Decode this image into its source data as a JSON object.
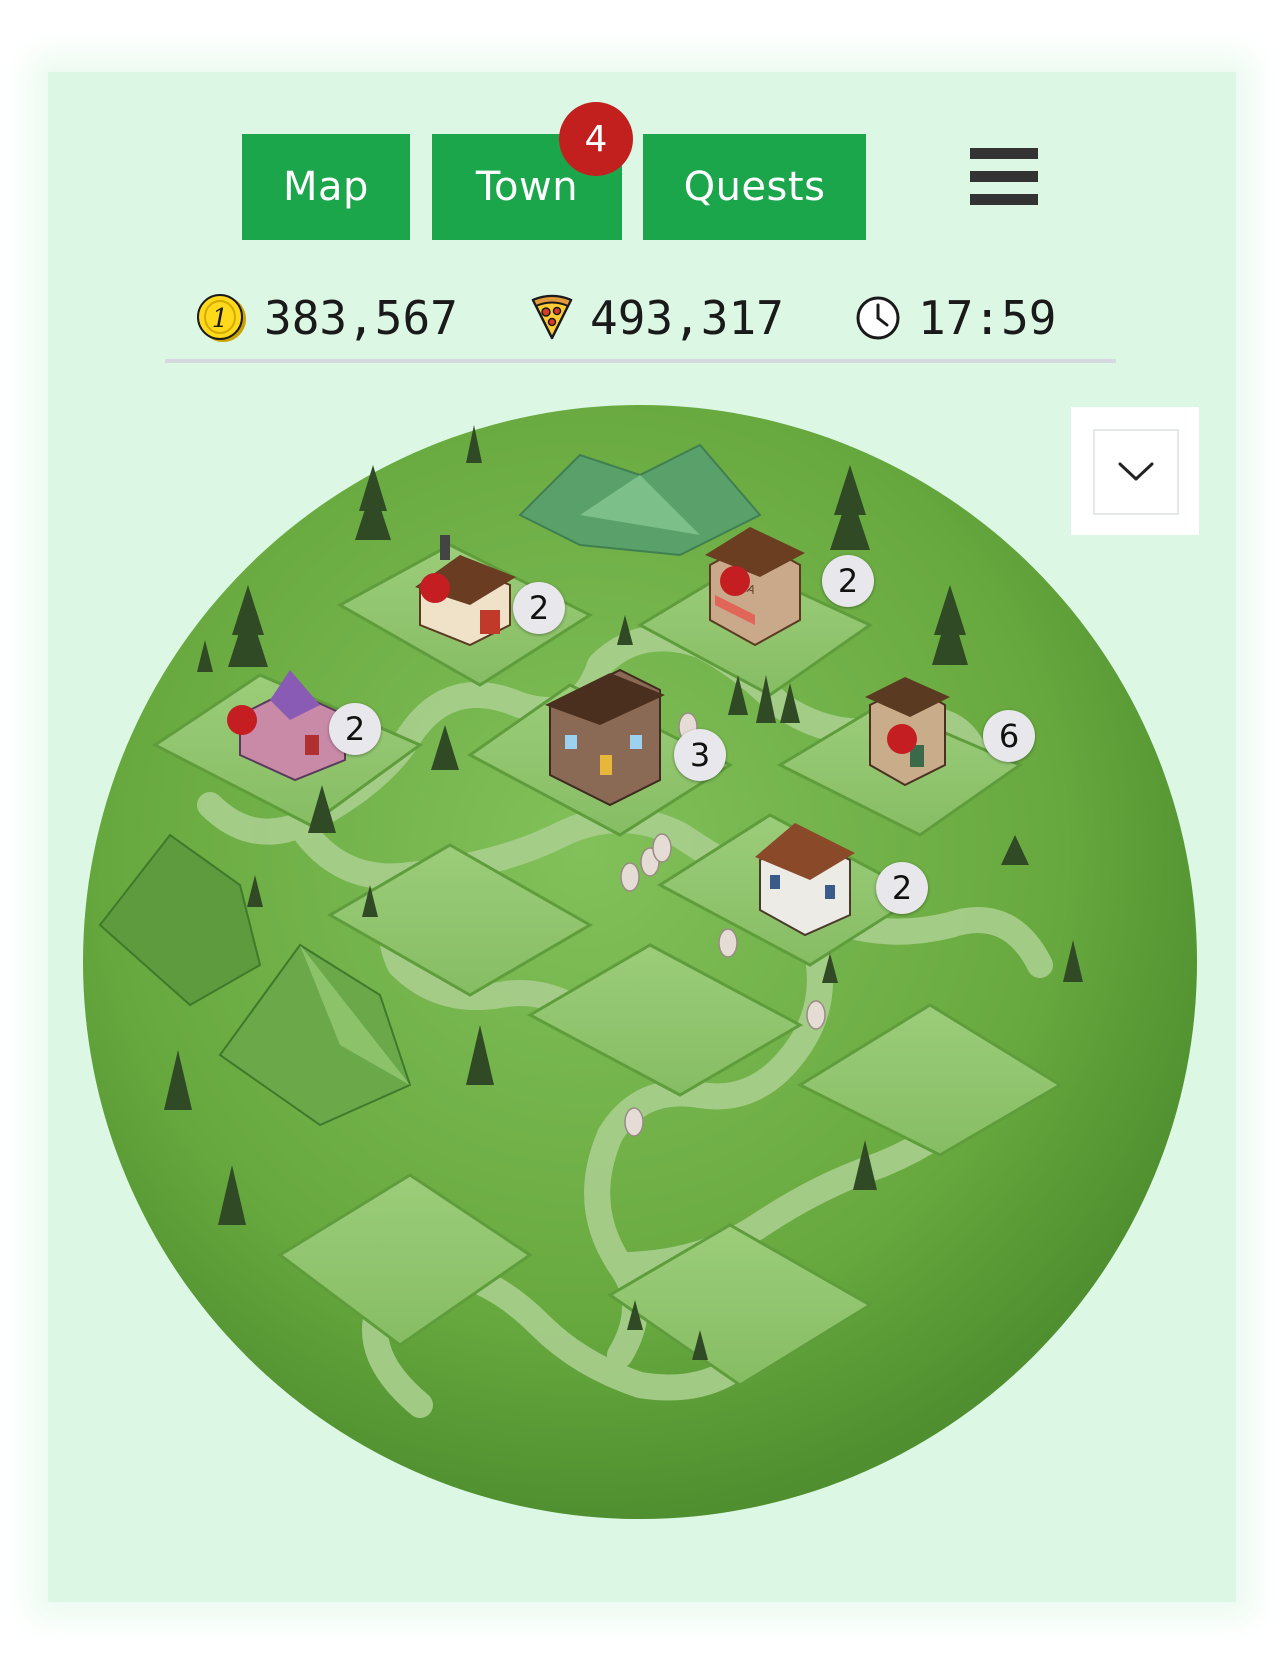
{
  "nav": {
    "map_label": "Map",
    "town_label": "Town",
    "town_badge": "4",
    "quests_label": "Quests",
    "menu_icon": "hamburger-menu-icon"
  },
  "stats": {
    "coins": "383,567",
    "coins_icon": "coin-icon",
    "pizza": "493,317",
    "pizza_icon": "pizza-slice-icon",
    "timer": "17:59",
    "timer_icon": "clock-icon"
  },
  "map": {
    "dropdown_icon": "chevron-down-icon",
    "buildings": [
      {
        "name": "bakery",
        "count": "2",
        "alert": true
      },
      {
        "name": "pizza-shop",
        "count": "2",
        "alert": true
      },
      {
        "name": "purple-house",
        "count": "2",
        "alert": true
      },
      {
        "name": "town-hall",
        "count": "3",
        "alert": false
      },
      {
        "name": "shop",
        "count": "6",
        "alert": true
      },
      {
        "name": "cottage",
        "count": "2",
        "alert": false
      }
    ]
  },
  "colors": {
    "button_green": "#1ba64c",
    "badge_red": "#c21f1f",
    "background": "#dcf8e4",
    "map_green": "#6fb247"
  }
}
